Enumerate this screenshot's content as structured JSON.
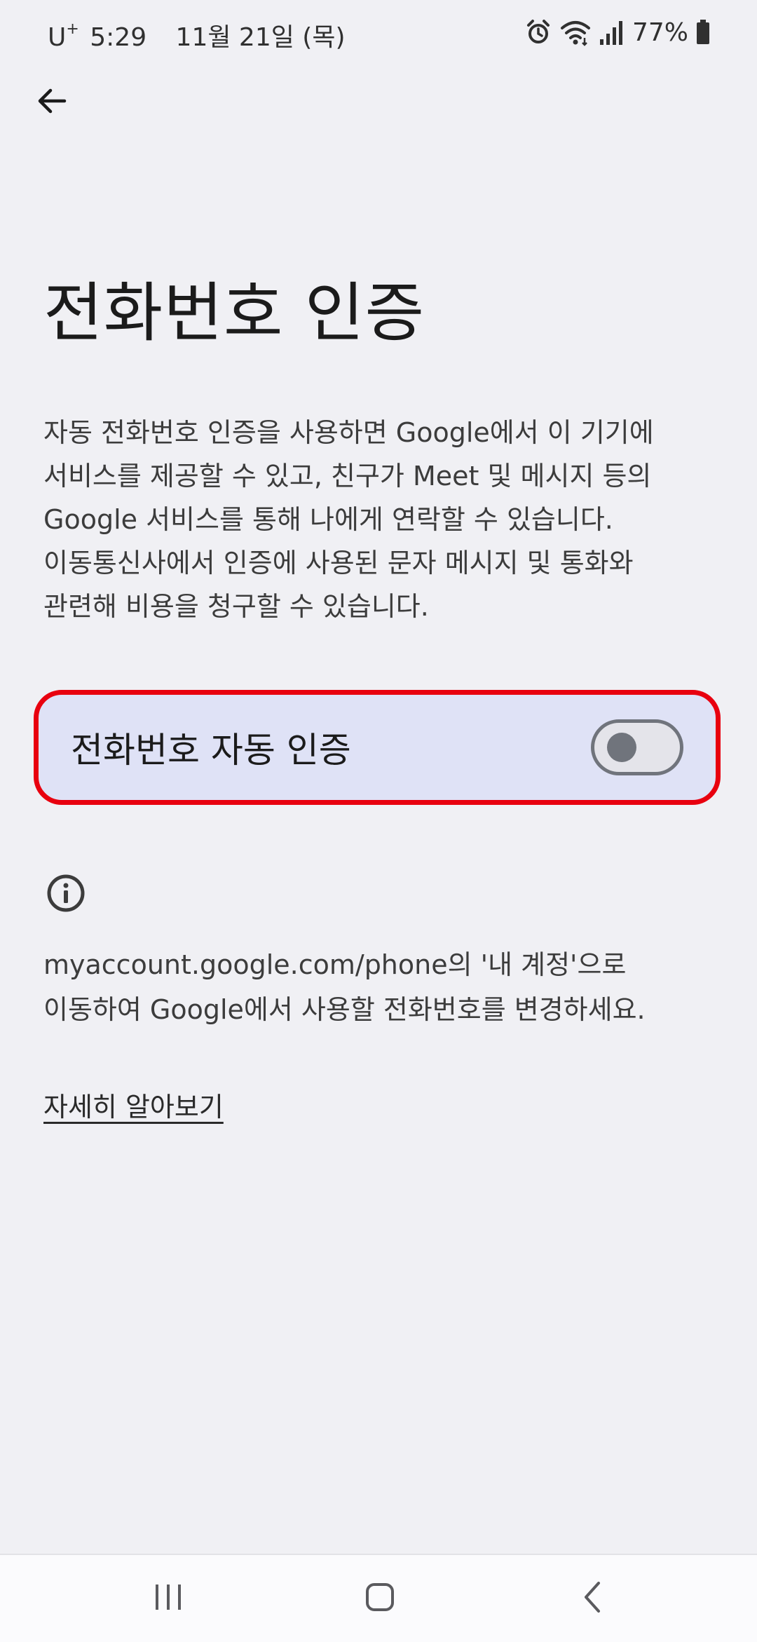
{
  "status_bar": {
    "carrier": "U",
    "carrier_sup": "+",
    "time": "5:29",
    "date": "11월 21일 (목)",
    "battery": "77%",
    "icons": [
      "alarm-icon",
      "wifi-icon",
      "signal-icon",
      "battery-icon"
    ]
  },
  "header": {
    "back_icon": "arrow-left-icon"
  },
  "page": {
    "title": "전화번호 인증",
    "description": "자동 전화번호 인증을 사용하면 Google에서 이 기기에\n서비스를 제공할 수 있고, 친구가 Meet 및 메시지 등의\nGoogle 서비스를 통해 나에게 연락할 수 있습니다.\n이동통신사에서 인증에 사용된 문자 메시지 및 통화와\n관련해 비용을 청구할 수 있습니다."
  },
  "toggle_row": {
    "label": "전화번호 자동 인증",
    "enabled": false,
    "highlight_color": "#e8000f",
    "background_color": "#dfe2f6"
  },
  "info": {
    "icon": "info-icon",
    "text": "myaccount.google.com/phone의 '내 계정'으로\n이동하여 Google에서 사용할 전화번호를 변경하세요.",
    "learn_more": "자세히 알아보기"
  },
  "nav_bar": {
    "buttons": [
      "recents-icon",
      "home-icon",
      "back-icon"
    ]
  }
}
